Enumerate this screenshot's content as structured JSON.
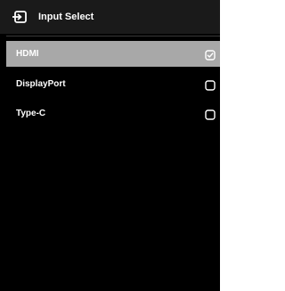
{
  "header": {
    "icon": "input-source-icon",
    "title": "Input Select"
  },
  "options": [
    {
      "label": "HDMI",
      "checked": true
    },
    {
      "label": "DisplayPort",
      "checked": false
    },
    {
      "label": "Type-C",
      "checked": false
    }
  ],
  "colors": {
    "background": "#000000",
    "header_background": "#1a1a1a",
    "selected_background": "#a8a8a8",
    "text": "#ffffff"
  }
}
